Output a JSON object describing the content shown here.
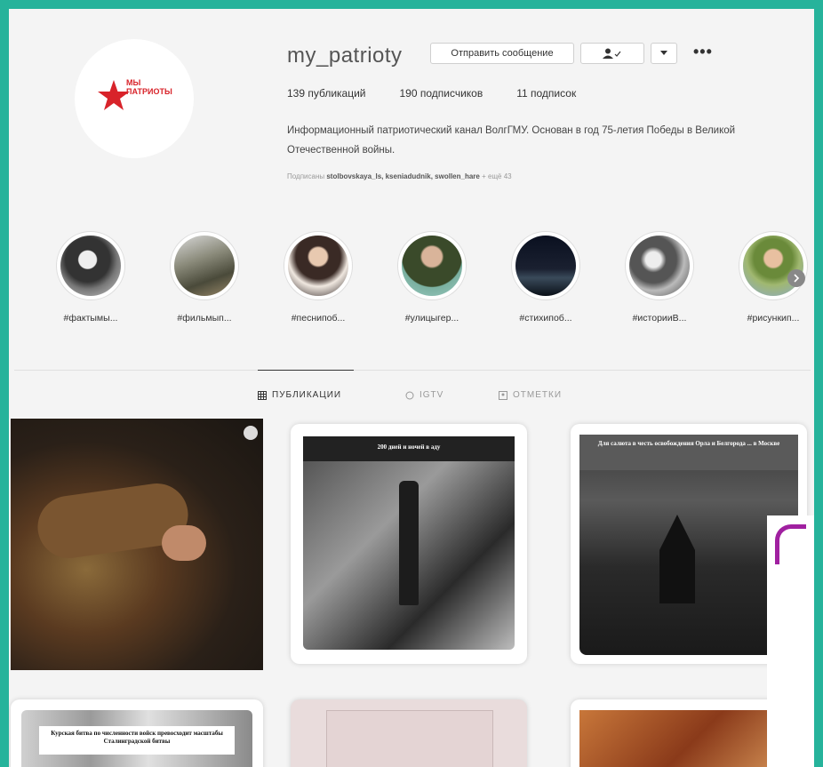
{
  "profile": {
    "username": "my_patrioty",
    "logo_text": "МЫ ПАТРИОТЫ",
    "message_button": "Отправить сообщение",
    "follow_icon": "person-check-icon",
    "dropdown_icon": "chevron-down-icon",
    "more": "•••",
    "stats": {
      "posts": "139 публикаций",
      "followers": "190 подписчиков",
      "following": "11 подписок"
    },
    "bio": "Информационный патриотический канал ВолгГМУ. Основан в год 75-летия Победы в Великой Отечественной войны.",
    "followed_by_prefix": "Подписаны",
    "followed_by_names": "stolbovskaya_ls, kseniadudnik, swollen_hare",
    "followed_by_suffix": "+ ещё 43"
  },
  "highlights": [
    {
      "label": "#фактымы..."
    },
    {
      "label": "#фильмып..."
    },
    {
      "label": "#песнипоб..."
    },
    {
      "label": "#улицыгер..."
    },
    {
      "label": "#стихипоб..."
    },
    {
      "label": "#историиВ..."
    },
    {
      "label": "#рисункип..."
    }
  ],
  "tabs": {
    "posts": "ПУБЛИКАЦИИ",
    "igtv": "IGTV",
    "tagged": "ОТМЕТКИ"
  },
  "posts": [
    {
      "caption": ""
    },
    {
      "caption": "200 дней и ночей в аду"
    },
    {
      "caption": "Для салюта в честь освобождения Орла и Белгорода ... в Москве"
    },
    {
      "caption": "Курская битва по численности войск превосходит масштабы Сталинградской битвы"
    },
    {
      "caption": ""
    },
    {
      "caption": ""
    }
  ],
  "colors": {
    "background": "#26b39b",
    "panel": "#f4f4f4",
    "logo_red": "#d8232a",
    "accent_bracket": "#a020a0"
  }
}
